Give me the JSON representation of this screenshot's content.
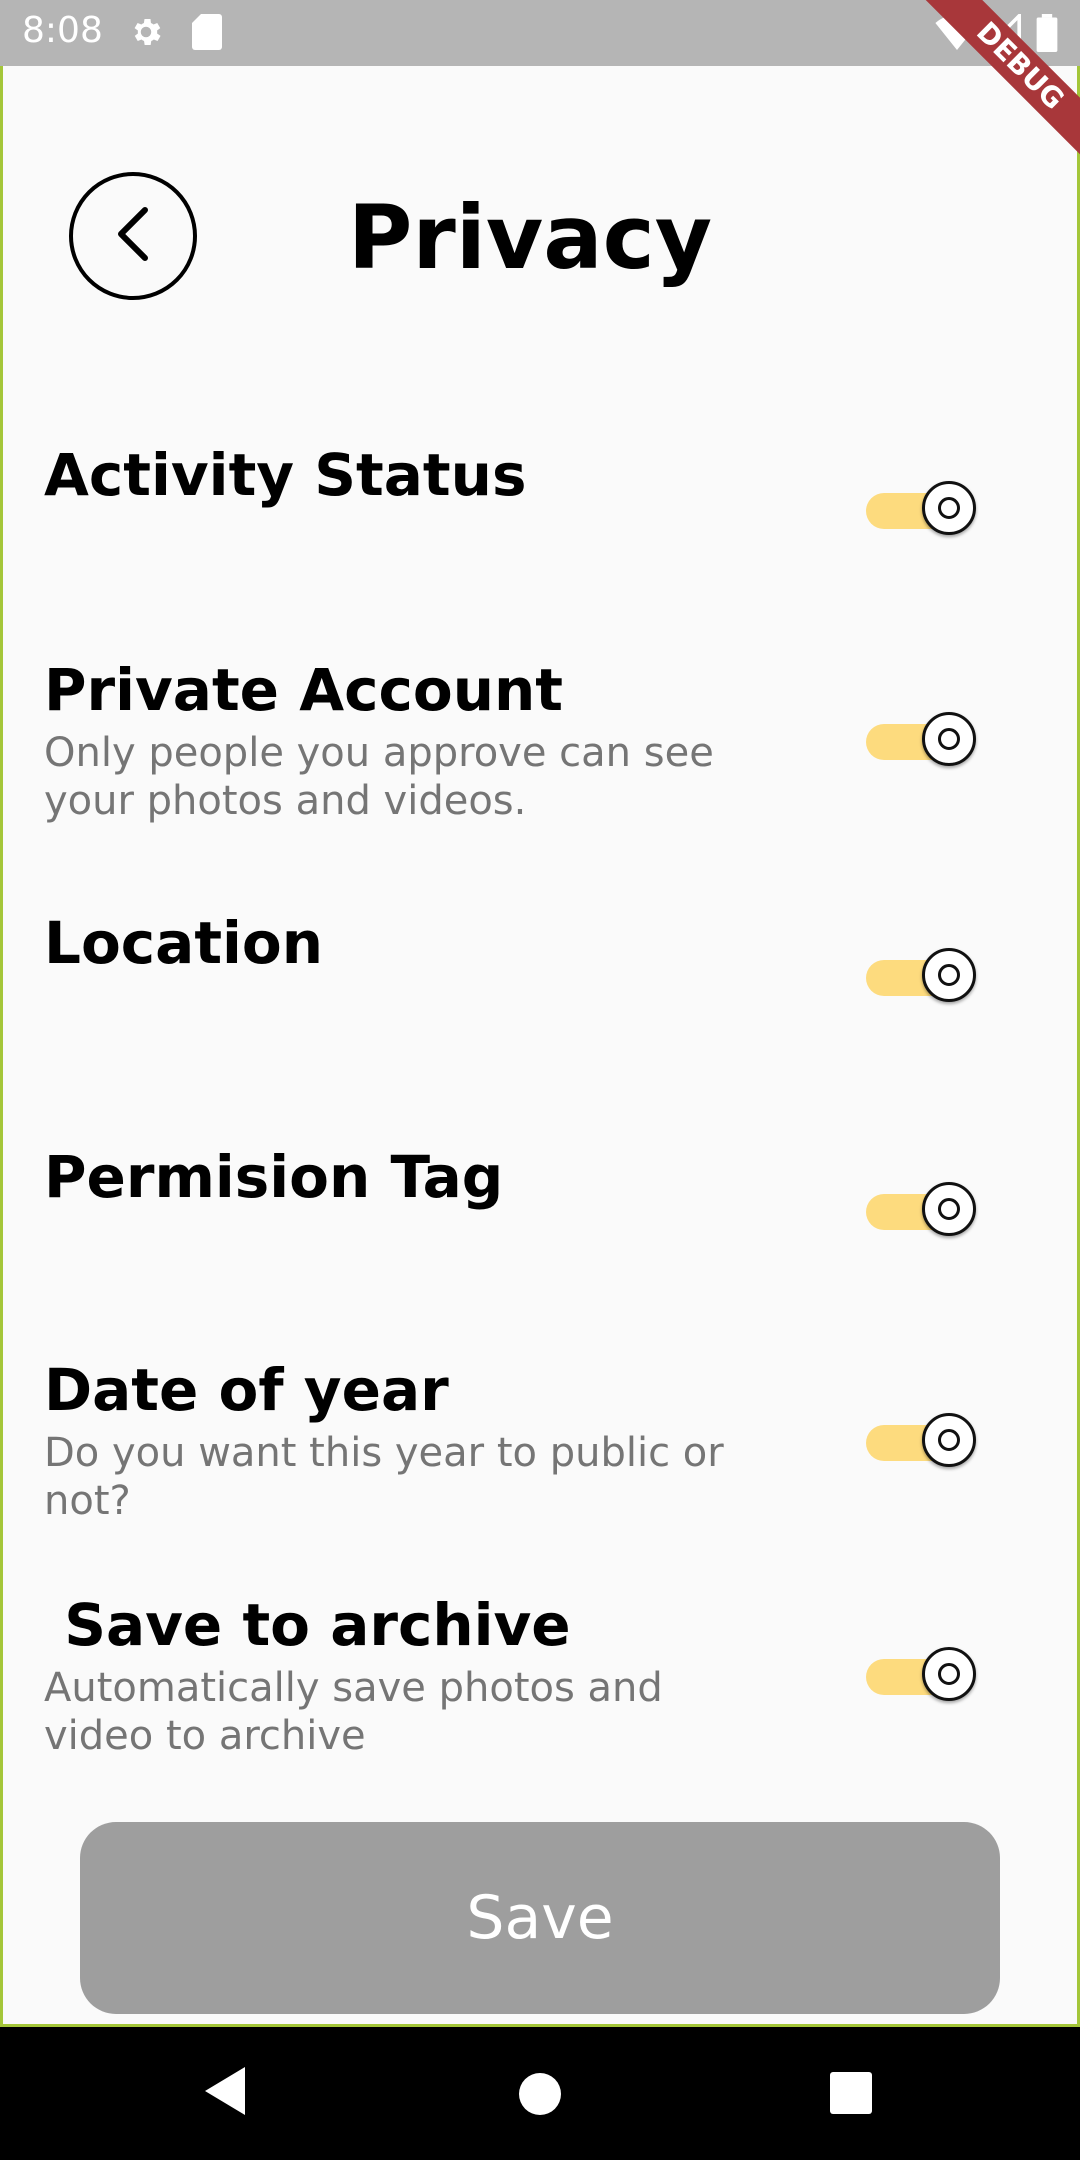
{
  "status_bar": {
    "time": "8:08",
    "debug_label": "DEBUG"
  },
  "header": {
    "title": "Privacy"
  },
  "settings": [
    {
      "title": "Activity Status",
      "subtitle": "",
      "enabled": true
    },
    {
      "title": "Private Account",
      "subtitle": "Only people you approve can see your photos and videos.",
      "enabled": true
    },
    {
      "title": "Location",
      "subtitle": "",
      "enabled": true
    },
    {
      "title": "Permision Tag",
      "subtitle": "",
      "enabled": true
    },
    {
      "title": "Date of year",
      "subtitle": "Do you want this year to public or not?",
      "enabled": true
    },
    {
      "title": " Save to archive",
      "subtitle": "Automatically save photos and video to archive",
      "enabled": true
    }
  ],
  "save_button": {
    "label": "Save"
  },
  "colors": {
    "accent_track": "#fddb7e",
    "button_gray": "#9e9e9e",
    "status_bar": "#b5b5b5"
  }
}
